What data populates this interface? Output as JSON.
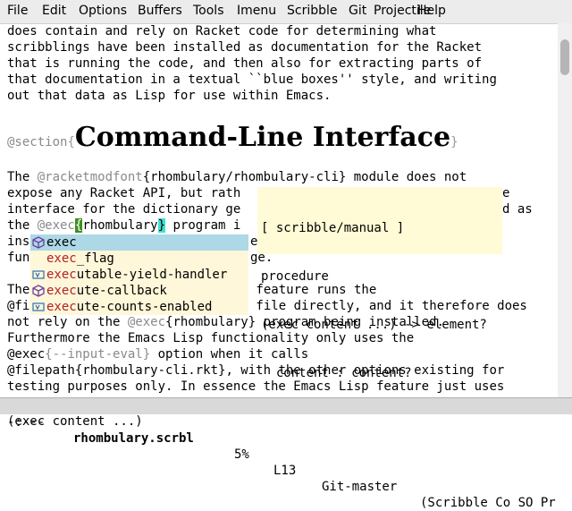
{
  "menu": [
    "File",
    "Edit",
    "Options",
    "Buffers",
    "Tools",
    "Imenu",
    "Scribble",
    "Git",
    "Projectile",
    "Help"
  ],
  "text": {
    "l1": "does contain and rely on Racket code for determining what",
    "l2": "scribblings have been installed as documentation for the Racket",
    "l3": "that is running the code, and then also for extracting parts of",
    "l4": "that documentation in a textual ``blue boxes'' style, and writing",
    "l5": "out that data as Lisp for use within Emacs.",
    "sec_cmd": "@section",
    "sec_open": "{",
    "sec_title": "Command-Line Interface",
    "sec_close": "}",
    "p2_a": "The ",
    "p2_cmd": "@racketmodfont",
    "p2_b": "{rhombulary/rhombulary-cli} module does not",
    "p3": "expose any Racket API, but rath",
    "p3r": "e",
    "p4": "interface for the dictionary ge",
    "p4r": "d as",
    "p5_a": "the ",
    "p5_cmd": "@exec",
    "p5_cur": "{",
    "p5_b": "rhombulary",
    "p5_brace": "}",
    "p5_c": " program i",
    "p6": "ins",
    "p6r": "e",
    "p7": "fun",
    "p7r": "ge.",
    "p8": "The",
    "p8r": " feature runs the",
    "p9": "@fi",
    "p9r": " file directly, and it therefore does",
    "p10_a": "not rely on the ",
    "p10_cmd": "@exec",
    "p10_b": "{rhombulary}",
    "p10_c": " program being installed.",
    "p11": "Furthermore the Emacs Lisp functionality only uses the",
    "p12_cmd": "@exec",
    "p12_b": "{--input-eval}",
    "p12_c": " option when it calls",
    "p13_cmd": "@filepath",
    "p13_b": "{rhombulary-cli.rkt}",
    "p13_c": ", with the other options existing for",
    "p14": "testing purposes only. In essence the Emacs Lisp feature just uses"
  },
  "completion": {
    "prefix": "exec",
    "items": [
      {
        "match": "exec",
        "rest": "",
        "icon": "package-icon",
        "selected": true
      },
      {
        "match": "exec",
        "rest": "_flag",
        "icon": "none",
        "selected": false
      },
      {
        "match": "exec",
        "rest": "utable-yield-handler",
        "icon": "variable-icon",
        "selected": false
      },
      {
        "match": "exec",
        "rest": "ute-callback",
        "icon": "package-icon",
        "selected": false
      },
      {
        "match": "exec",
        "rest": "ute-counts-enabled",
        "icon": "variable-icon",
        "selected": false
      }
    ]
  },
  "doc": {
    "line1": "[ scribble/manual ]",
    "line2": "procedure",
    "line3": "(exec content ...) -> element?",
    "line4": "  content : content?"
  },
  "modeline": {
    "status": "-:---",
    "buffer": "rhombulary.scrbl",
    "percent": "5%",
    "line": "L13",
    "vc": "Git-master",
    "modes": "(Scribble Co SO Pr"
  },
  "echo": "(exec content ...)"
}
